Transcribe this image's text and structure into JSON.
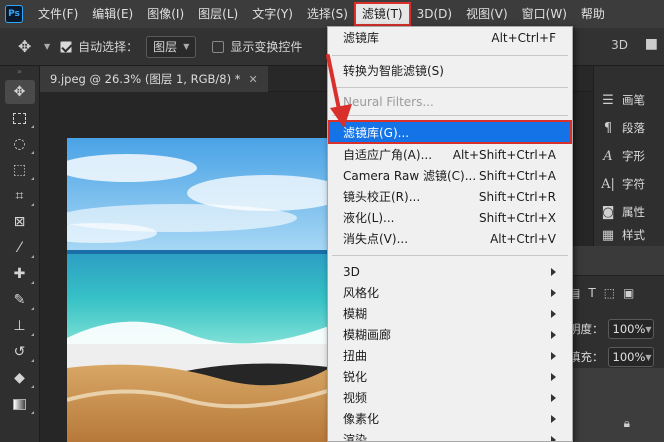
{
  "app": {
    "logo": "Ps"
  },
  "menubar": {
    "items": [
      {
        "label": "文件(F)"
      },
      {
        "label": "编辑(E)"
      },
      {
        "label": "图像(I)"
      },
      {
        "label": "图层(L)"
      },
      {
        "label": "文字(Y)"
      },
      {
        "label": "选择(S)"
      },
      {
        "label": "滤镜(T)"
      },
      {
        "label": "3D(D)"
      },
      {
        "label": "视图(V)"
      },
      {
        "label": "窗口(W)"
      },
      {
        "label": "帮助"
      }
    ]
  },
  "options": {
    "auto_select_label": "自动选择：",
    "auto_select_value": "图层",
    "show_transform_label": "显示变换控件"
  },
  "document": {
    "tab_title": "9.jpeg @ 26.3% (图层 1, RGB/8) *"
  },
  "filter_menu": {
    "items": [
      {
        "label": "滤镜库",
        "shortcut": "Alt+Ctrl+F"
      },
      {
        "label": "转换为智能滤镜(S)",
        "shortcut": ""
      },
      {
        "label": "Neural Filters...",
        "shortcut": ""
      },
      {
        "label": "滤镜库(G)...",
        "shortcut": ""
      },
      {
        "label": "自适应广角(A)...",
        "shortcut": "Alt+Shift+Ctrl+A"
      },
      {
        "label": "Camera Raw 滤镜(C)...",
        "shortcut": "Shift+Ctrl+A"
      },
      {
        "label": "镜头校正(R)...",
        "shortcut": "Shift+Ctrl+R"
      },
      {
        "label": "液化(L)...",
        "shortcut": "Shift+Ctrl+X"
      },
      {
        "label": "消失点(V)...",
        "shortcut": "Alt+Ctrl+V"
      },
      {
        "label": "3D"
      },
      {
        "label": "风格化"
      },
      {
        "label": "模糊"
      },
      {
        "label": "模糊画廊"
      },
      {
        "label": "扭曲"
      },
      {
        "label": "锐化"
      },
      {
        "label": "视频"
      },
      {
        "label": "像素化"
      },
      {
        "label": "渲染"
      }
    ]
  },
  "right_panel": {
    "items": [
      {
        "label": "画笔",
        "icon": "brush-settings-icon"
      },
      {
        "label": "段落",
        "icon": "paragraph-icon"
      },
      {
        "label": "字形",
        "icon": "glyphs-icon"
      },
      {
        "label": "字符",
        "icon": "character-icon"
      },
      {
        "label": "属性",
        "icon": "properties-icon"
      },
      {
        "label": "样式",
        "icon": "styles-icon"
      }
    ]
  },
  "layers_panel": {
    "opacity_label": "明度：",
    "opacity_value": "100%",
    "fill_label": "填充：",
    "fill_value": "100%"
  },
  "colors": {
    "menu_highlight": "#1473e6",
    "annotation_red": "#d9302b"
  }
}
